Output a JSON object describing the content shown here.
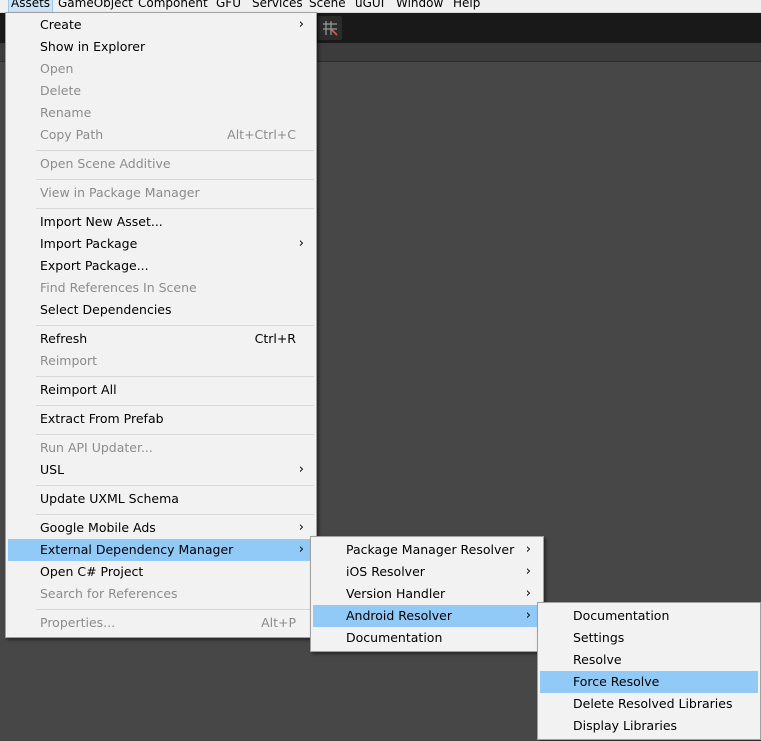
{
  "menubar": {
    "items": [
      "Assets",
      "GameObject",
      "Component",
      "GFU",
      "Services",
      "Scene",
      "uGUI",
      "Window",
      "Help"
    ]
  },
  "assets_menu": {
    "items": [
      {
        "label": "Create",
        "submenu": true
      },
      {
        "label": "Show in Explorer"
      },
      {
        "label": "Open",
        "disabled": true
      },
      {
        "label": "Delete",
        "disabled": true
      },
      {
        "label": "Rename",
        "disabled": true
      },
      {
        "label": "Copy Path",
        "shortcut": "Alt+Ctrl+C",
        "disabled": true
      },
      {
        "label": "Open Scene Additive",
        "disabled": true
      },
      {
        "label": "View in Package Manager",
        "disabled": true
      },
      {
        "label": "Import New Asset..."
      },
      {
        "label": "Import Package",
        "submenu": true
      },
      {
        "label": "Export Package..."
      },
      {
        "label": "Find References In Scene",
        "disabled": true
      },
      {
        "label": "Select Dependencies"
      },
      {
        "label": "Refresh",
        "shortcut": "Ctrl+R"
      },
      {
        "label": "Reimport",
        "disabled": true
      },
      {
        "label": "Reimport All"
      },
      {
        "label": "Extract From Prefab"
      },
      {
        "label": "Run API Updater...",
        "disabled": true
      },
      {
        "label": "USL",
        "submenu": true
      },
      {
        "label": "Update UXML Schema"
      },
      {
        "label": "Google Mobile Ads",
        "submenu": true
      },
      {
        "label": "External Dependency Manager",
        "submenu": true,
        "highlighted": true
      },
      {
        "label": "Open C# Project"
      },
      {
        "label": "Search for References",
        "disabled": true
      },
      {
        "label": "Properties...",
        "shortcut": "Alt+P",
        "disabled": true
      }
    ]
  },
  "edm_menu": {
    "items": [
      {
        "label": "Package Manager Resolver",
        "submenu": true
      },
      {
        "label": "iOS Resolver",
        "submenu": true
      },
      {
        "label": "Version Handler",
        "submenu": true
      },
      {
        "label": "Android Resolver",
        "submenu": true,
        "highlighted": true
      },
      {
        "label": "Documentation"
      }
    ]
  },
  "android_menu": {
    "items": [
      {
        "label": "Documentation"
      },
      {
        "label": "Settings"
      },
      {
        "label": "Resolve"
      },
      {
        "label": "Force Resolve",
        "highlighted": true
      },
      {
        "label": "Delete Resolved Libraries"
      },
      {
        "label": "Display Libraries"
      }
    ]
  },
  "icons": {
    "submenu_arrow": "chevron-right-icon",
    "toolbar_grid": "grid-snap-icon"
  },
  "colors": {
    "highlight": "#91c9f7",
    "menu_bg": "#f2f2f2",
    "disabled_text": "#8c8c8c",
    "editor_bg": "#474747"
  }
}
